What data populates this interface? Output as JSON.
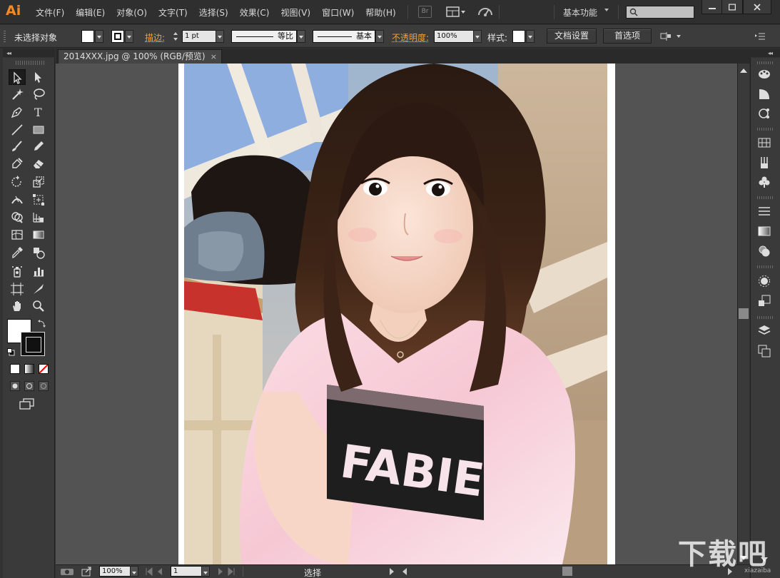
{
  "app": {
    "logo": "Ai",
    "menu": [
      "文件(F)",
      "编辑(E)",
      "对象(O)",
      "文字(T)",
      "选择(S)",
      "效果(C)",
      "视图(V)",
      "窗口(W)",
      "帮助(H)"
    ],
    "bridge_badge": "Br",
    "workspace": "基本功能",
    "search_placeholder": ""
  },
  "control_bar": {
    "selection_status": "未选择对象",
    "stroke_label": "描边:",
    "stroke_weight": "1 pt",
    "stroke_profile": "等比",
    "brush_profile": "基本",
    "opacity_label": "不透明度:",
    "opacity_value": "100%",
    "style_label": "样式:",
    "doc_setup_button": "文档设置",
    "preferences_button": "首选项"
  },
  "document": {
    "tab_title": "2014XXX.jpg @ 100% (RGB/预览)",
    "tab_close": "×"
  },
  "status_bar": {
    "zoom": "100%",
    "page": "1",
    "tool_status": "选择"
  },
  "watermark": {
    "text": "下载吧",
    "sub": "xiazaiba"
  },
  "colors": {
    "accent_orange": "#ef8b2a",
    "chrome_dark": "#323232",
    "canvas_bg": "#535353"
  }
}
